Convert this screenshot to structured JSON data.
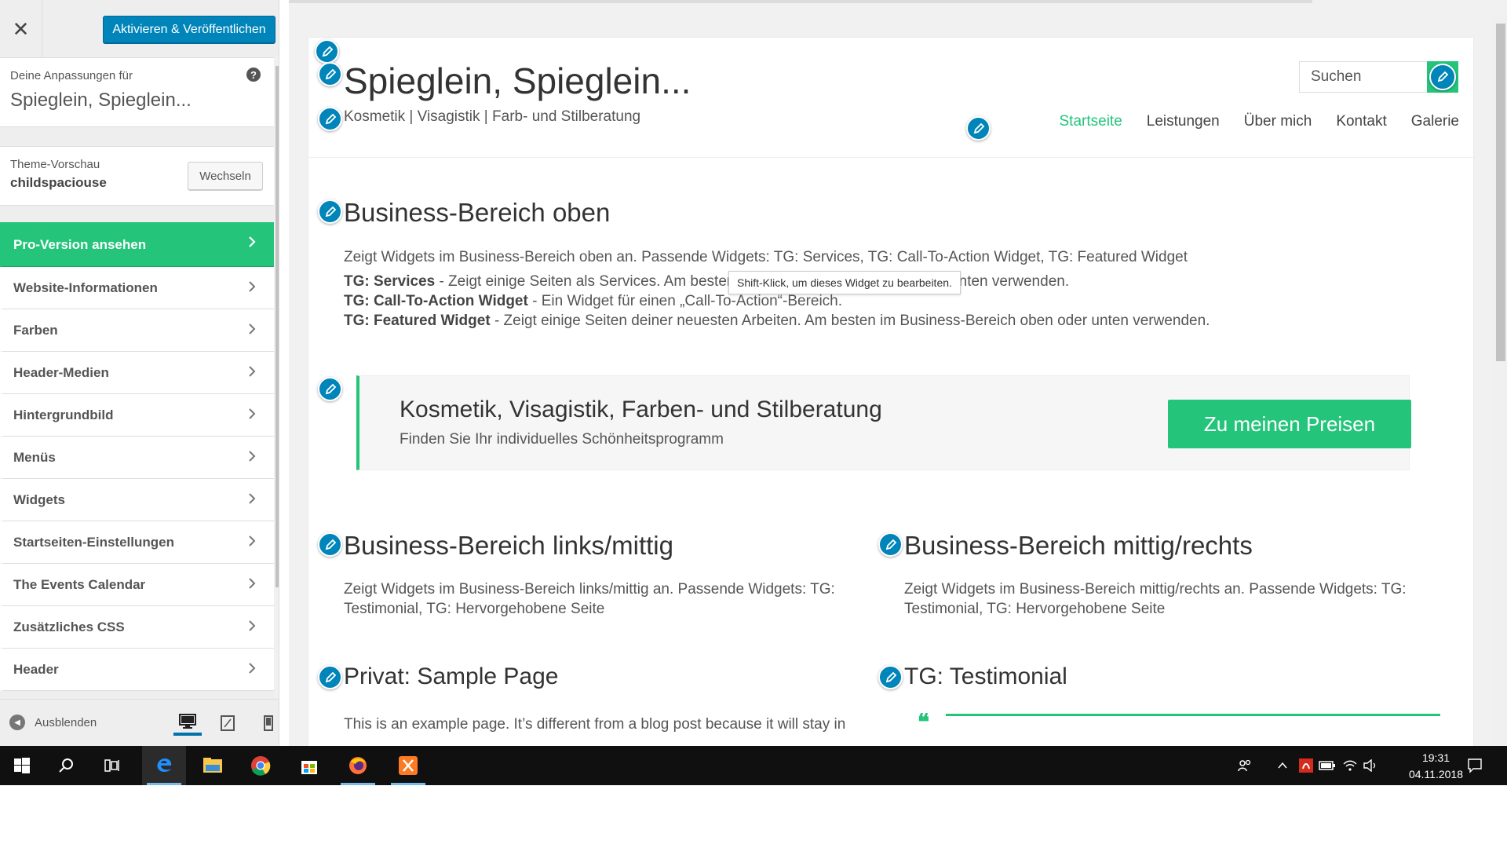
{
  "sidebar": {
    "close_symbol": "✕",
    "publish_label": "Aktivieren & Veröffentlichen",
    "info_label": "Deine Anpassungen für",
    "info_title": "Spieglein, Spieglein...",
    "help_symbol": "?",
    "theme_label": "Theme-Vorschau",
    "theme_name": "childspaciouse",
    "switch_label": "Wechseln",
    "items": [
      {
        "label": "Pro-Version ansehen"
      },
      {
        "label": "Website-Informationen"
      },
      {
        "label": "Farben"
      },
      {
        "label": "Header-Medien"
      },
      {
        "label": "Hintergrundbild"
      },
      {
        "label": "Menüs"
      },
      {
        "label": "Widgets"
      },
      {
        "label": "Startseiten-Einstellungen"
      },
      {
        "label": "The Events Calendar"
      },
      {
        "label": "Zusätzliches CSS"
      },
      {
        "label": "Header"
      }
    ],
    "hide_label": "Ausblenden",
    "devices": [
      "desktop-icon",
      "tablet-icon",
      "mobile-icon"
    ]
  },
  "site": {
    "title": "Spieglein, Spieglein...",
    "tagline": "Kosmetik | Visagistik | Farb- und Stilberatung",
    "search_placeholder": "Suchen",
    "nav": [
      "Startseite",
      "Leistungen",
      "Über mich",
      "Kontakt",
      "Galerie"
    ],
    "active_nav": "Startseite"
  },
  "sections": {
    "business_top": {
      "heading": "Business-Bereich oben",
      "description": "Zeigt Widgets im Business-Bereich oben an. Passende Widgets: TG: Services, TG: Call-To-Action Widget, TG: Featured Widget",
      "lines": [
        {
          "label": "TG: Services",
          "text": " - Zeigt einige Seiten als Services. Am besten im Business-Bereich oben oder unten verwenden."
        },
        {
          "label": "TG: Call-To-Action Widget",
          "text": " - Ein Widget für einen „Call-To-Action“-Bereich."
        },
        {
          "label": "TG: Featured Widget",
          "text": " - Zeigt einige Seiten deiner neuesten Arbeiten. Am besten im Business-Bereich oben oder unten verwenden."
        }
      ]
    },
    "tooltip": "Shift-Klick, um dieses Widget zu bearbeiten.",
    "cta": {
      "title": "Kosmetik, Visagistik, Farben- und Stilberatung",
      "subtitle": "Finden Sie Ihr individuelles Schönheitsprogramm",
      "button": "Zu meinen Preisen"
    },
    "business_left": {
      "heading": "Business-Bereich links/mittig",
      "text": "Zeigt Widgets im Business-Bereich links/mittig an. Passende Widgets: TG: Testimonial, TG: Hervorgehobene Seite"
    },
    "business_right": {
      "heading": "Business-Bereich mittig/rechts",
      "text": "Zeigt Widgets im Business-Bereich mittig/rechts an. Passende Widgets: TG: Testimonial, TG: Hervorgehobene Seite"
    },
    "sample_page": {
      "heading": "Privat: Sample Page",
      "text": "This is an example page. It’s different from a blog post because it will stay in"
    },
    "testimonial": {
      "heading": "TG: Testimonial",
      "quote_symbol": "❝"
    }
  },
  "taskbar": {
    "apps": [
      "windows-start-icon",
      "search-icon",
      "task-view-icon",
      "edge-icon",
      "file-explorer-icon",
      "chrome-icon",
      "store-icon",
      "firefox-icon",
      "xampp-icon"
    ],
    "time": "19:31",
    "date": "04.11.2018"
  },
  "colors": {
    "accent_green": "#24c47b",
    "wp_blue": "#0085ba",
    "taskbar": "#101010"
  }
}
